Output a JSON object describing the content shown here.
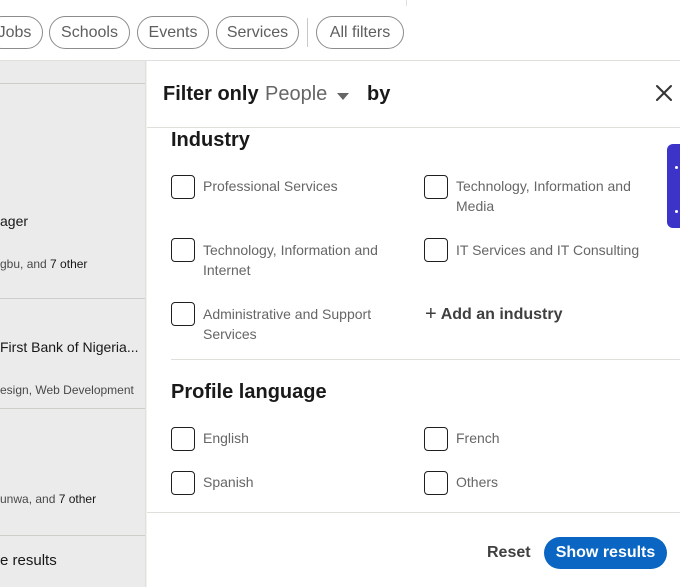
{
  "topbar": {
    "pills": [
      "Jobs",
      "Schools",
      "Events",
      "Services",
      "All filters"
    ]
  },
  "background": {
    "row1_title": "ager",
    "row1_sub_prefix": "gbu, and ",
    "row1_sub_count": "7 other",
    "row2_title": "First Bank of Nigeria...",
    "row2_sub": "esign, Web Development",
    "row3_sub_prefix": "unwa, and ",
    "row3_sub_count": "7 other",
    "results_text": "e results"
  },
  "panel": {
    "header": {
      "filter_only": "Filter only",
      "selected": "People",
      "by": "by"
    },
    "industry": {
      "title": "Industry",
      "options": [
        "Professional Services",
        "Technology, Information and Media",
        "Technology, Information and Internet",
        "IT Services and IT Consulting",
        "Administrative and Support Services"
      ],
      "add_label": "Add an industry"
    },
    "profile_language": {
      "title": "Profile language",
      "options": [
        "English",
        "French",
        "Spanish",
        "Others"
      ]
    },
    "footer": {
      "reset": "Reset",
      "show_results": "Show results"
    }
  },
  "icons": {
    "close": "close-icon",
    "caret": "caret-down-icon",
    "plus": "plus-icon"
  },
  "colors": {
    "primary": "#0a66c2",
    "side_tab": "#3c34c9"
  }
}
